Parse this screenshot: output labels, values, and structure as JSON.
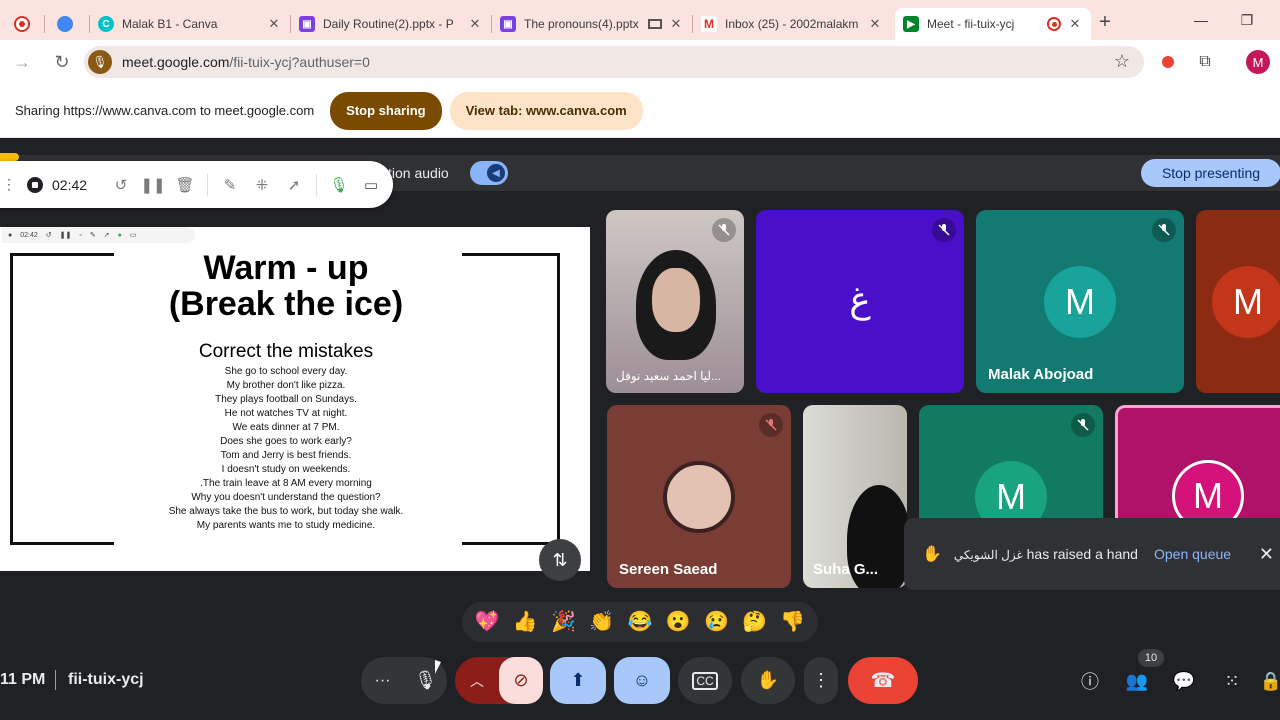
{
  "browser": {
    "tabs": [
      {
        "title": "",
        "icon": "recording-icon",
        "color": "#d93025"
      },
      {
        "title": "",
        "icon": "chrome-extension-icon",
        "color": "#4285f4"
      },
      {
        "title": "Malak B1 - Canva",
        "icon": "canva-icon",
        "color": "#00c4cc"
      },
      {
        "title": "Daily Routine(2).pptx - P",
        "icon": "presentation-icon",
        "color": "#7b3fe4"
      },
      {
        "title": "The pronouns(4).pptx",
        "icon": "presentation-icon",
        "color": "#7b3fe4"
      },
      {
        "title": "Inbox (25) - 2002malakm",
        "icon": "gmail-icon",
        "color": "#d93025"
      },
      {
        "title": "Meet - fii-tuix-ycj",
        "icon": "meet-icon",
        "color": "#00832d",
        "active": true
      }
    ],
    "url_host": "meet.google.com",
    "url_path": "/fii-tuix-ycj?authuser=0",
    "profile_initial": "M"
  },
  "sharebar": {
    "message": "Sharing https://www.canva.com to meet.google.com",
    "stop_label": "Stop sharing",
    "view_label": "View tab: www.canva.com"
  },
  "presenting": {
    "audio_label": "tion audio",
    "stop_presenting_label": "Stop presenting"
  },
  "recorder": {
    "time": "02:42",
    "mini_time": "02:42"
  },
  "slide": {
    "title_line1": "Warm - up",
    "title_line2": "(Break the ice)",
    "subtitle": "Correct the mistakes",
    "lines": [
      "She go to school every day.",
      "My brother don't like pizza.",
      "They plays football on Sundays.",
      "He not watches TV at night.",
      "We eats dinner at 7 PM.",
      "Does she goes to work early?",
      "Tom and Jerry is best friends.",
      "I doesn't study on weekends.",
      ".The train leave at 8 AM every morning",
      "Why you doesn't understand the question?",
      "She always take the bus to work, but today she walk.",
      "My parents wants me to study medicine."
    ]
  },
  "participants": [
    {
      "name": "ليا احمد سعيد نوفل...",
      "initial": ""
    },
    {
      "name": "",
      "initial": "غ"
    },
    {
      "name": "Malak Abojoad",
      "initial": "M"
    },
    {
      "name": "",
      "initial": "M"
    },
    {
      "name": "Sereen Saead",
      "initial": ""
    },
    {
      "name": "Suha G...",
      "initial": ""
    },
    {
      "name": "",
      "initial": "M"
    },
    {
      "name": "",
      "initial": "M"
    }
  ],
  "notification": {
    "name": "غزل الشويكي",
    "text": "has raised a hand",
    "action": "Open queue"
  },
  "reactions": [
    "💖",
    "👍",
    "🎉",
    "👏",
    "😂",
    "😮",
    "😢",
    "🤔",
    "👎"
  ],
  "footer": {
    "clock": "11 PM",
    "meeting_code": "fii-tuix-ycj",
    "participant_count": "10"
  },
  "colors": {
    "tabstrip": "#fbe3df",
    "stop_sharing": "#7a4a00",
    "stop_presenting": "#a8c7fa",
    "end_call": "#ea4335",
    "meet_bg": "#202124"
  }
}
